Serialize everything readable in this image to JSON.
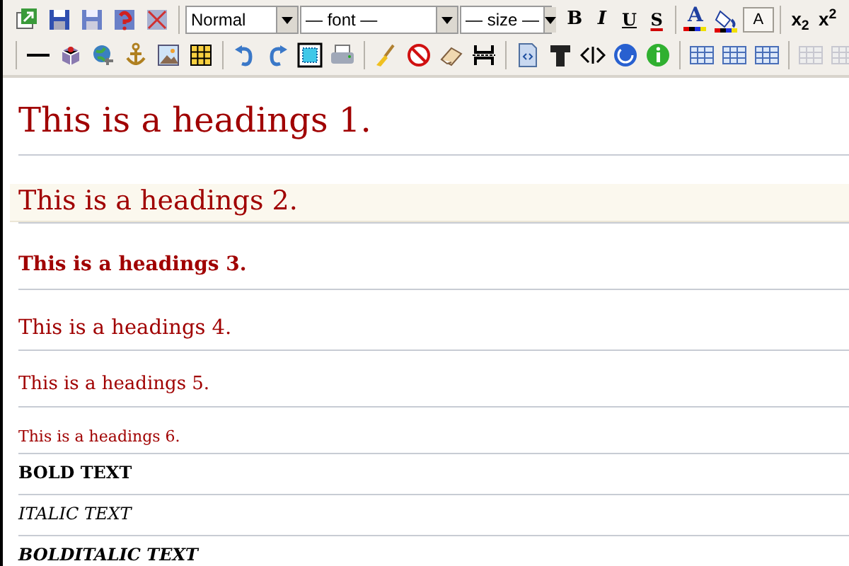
{
  "toolbar": {
    "block_format": "Normal",
    "font": "— font —",
    "size": "— size —",
    "bold": "B",
    "italic": "I",
    "underline": "U",
    "strike": "S",
    "text_color": "A",
    "style_box": "A",
    "subscript": "x$_{2}$",
    "superscript": "x$^{2}$",
    "table_buttons": [
      {
        "disabled": false
      },
      {
        "disabled": false
      },
      {
        "disabled": false
      },
      {
        "disabled": true
      },
      {
        "disabled": true
      }
    ]
  },
  "blocks": [
    {
      "kind": "h1",
      "text": "This is a headings 1.",
      "highlighted": false
    },
    {
      "kind": "h2",
      "text": "This is a headings 2.",
      "highlighted": true
    },
    {
      "kind": "h3",
      "text": "This is a headings 3.",
      "highlighted": false
    },
    {
      "kind": "h4",
      "text": "This is a headings 4.",
      "highlighted": false
    },
    {
      "kind": "h5",
      "text": "This is a headings 5.",
      "highlighted": false
    },
    {
      "kind": "h6",
      "text": "This is a headings 6.",
      "highlighted": false
    },
    {
      "kind": "bold",
      "text": "BOLD TEXT",
      "highlighted": false
    },
    {
      "kind": "italic",
      "text": "ITALIC TEXT",
      "highlighted": false
    },
    {
      "kind": "bolditalic",
      "text": "BOLDITALIC TEXT",
      "highlighted": false
    }
  ]
}
